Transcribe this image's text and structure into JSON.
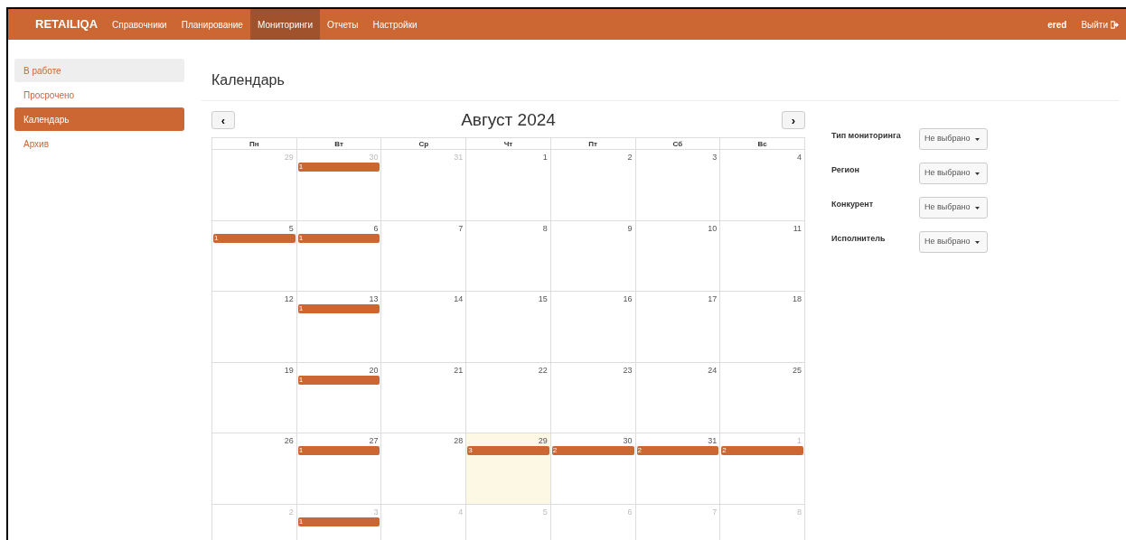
{
  "navbar": {
    "brand": "RETAILIQA",
    "items": [
      {
        "label": "Справочники",
        "selected": false
      },
      {
        "label": "Планирование",
        "selected": false
      },
      {
        "label": "Мониторинги",
        "selected": true
      },
      {
        "label": "Отчеты",
        "selected": false
      },
      {
        "label": "Настройки",
        "selected": false
      }
    ],
    "user": "ered",
    "logout": "Выйти"
  },
  "sidebar": {
    "items": [
      {
        "label": "В работе",
        "selected": false,
        "hovered": true
      },
      {
        "label": "Просрочено",
        "selected": false
      },
      {
        "label": "Календарь",
        "selected": true
      },
      {
        "label": "Архив",
        "selected": false
      }
    ]
  },
  "page_title": "Календарь",
  "calendar": {
    "prev": "‹",
    "next": "›",
    "month": "Август 2024",
    "weekdays": [
      "Пн",
      "Вт",
      "Ср",
      "Чт",
      "Пт",
      "Сб",
      "Вс"
    ],
    "weeks": [
      [
        {
          "day": "29",
          "other_month": true,
          "today": false
        },
        {
          "day": "30",
          "other_month": true,
          "today": false,
          "events": [
            "1"
          ]
        },
        {
          "day": "31",
          "other_month": true,
          "today": false
        },
        {
          "day": "1",
          "other_month": false,
          "today": false
        },
        {
          "day": "2",
          "other_month": false,
          "today": false
        },
        {
          "day": "3",
          "other_month": false,
          "today": false
        },
        {
          "day": "4",
          "other_month": false,
          "today": false
        }
      ],
      [
        {
          "day": "5",
          "other_month": false,
          "today": false,
          "events": [
            "1"
          ]
        },
        {
          "day": "6",
          "other_month": false,
          "today": false,
          "events": [
            "1"
          ]
        },
        {
          "day": "7",
          "other_month": false,
          "today": false
        },
        {
          "day": "8",
          "other_month": false,
          "today": false
        },
        {
          "day": "9",
          "other_month": false,
          "today": false
        },
        {
          "day": "10",
          "other_month": false,
          "today": false
        },
        {
          "day": "11",
          "other_month": false,
          "today": false
        }
      ],
      [
        {
          "day": "12",
          "other_month": false,
          "today": false
        },
        {
          "day": "13",
          "other_month": false,
          "today": false,
          "events": [
            "1"
          ]
        },
        {
          "day": "14",
          "other_month": false,
          "today": false
        },
        {
          "day": "15",
          "other_month": false,
          "today": false
        },
        {
          "day": "16",
          "other_month": false,
          "today": false
        },
        {
          "day": "17",
          "other_month": false,
          "today": false
        },
        {
          "day": "18",
          "other_month": false,
          "today": false
        }
      ],
      [
        {
          "day": "19",
          "other_month": false,
          "today": false
        },
        {
          "day": "20",
          "other_month": false,
          "today": false,
          "events": [
            "1"
          ]
        },
        {
          "day": "21",
          "other_month": false,
          "today": false
        },
        {
          "day": "22",
          "other_month": false,
          "today": false
        },
        {
          "day": "23",
          "other_month": false,
          "today": false
        },
        {
          "day": "24",
          "other_month": false,
          "today": false
        },
        {
          "day": "25",
          "other_month": false,
          "today": false
        }
      ],
      [
        {
          "day": "26",
          "other_month": false,
          "today": false
        },
        {
          "day": "27",
          "other_month": false,
          "today": false,
          "events": [
            "1"
          ]
        },
        {
          "day": "28",
          "other_month": false,
          "today": false
        },
        {
          "day": "29",
          "other_month": false,
          "today": true,
          "events": [
            "3"
          ]
        },
        {
          "day": "30",
          "other_month": false,
          "today": false,
          "events": [
            "2"
          ]
        },
        {
          "day": "31",
          "other_month": false,
          "today": false,
          "events": [
            "2"
          ]
        },
        {
          "day": "1",
          "other_month": true,
          "today": false,
          "events": [
            "2"
          ]
        }
      ],
      [
        {
          "day": "2",
          "other_month": true,
          "today": false
        },
        {
          "day": "3",
          "other_month": true,
          "today": false,
          "events": [
            "1"
          ]
        },
        {
          "day": "4",
          "other_month": true,
          "today": false
        },
        {
          "day": "5",
          "other_month": true,
          "today": false
        },
        {
          "day": "6",
          "other_month": true,
          "today": false
        },
        {
          "day": "7",
          "other_month": true,
          "today": false
        },
        {
          "day": "8",
          "other_month": true,
          "today": false
        }
      ]
    ]
  },
  "filters": [
    {
      "label": "Тип мониторинга",
      "value": "Не выбрано"
    },
    {
      "label": "Регион",
      "value": "Не выбрано"
    },
    {
      "label": "Конкурент",
      "value": "Не выбрано"
    },
    {
      "label": "Исполнитель",
      "value": "Не выбрано"
    }
  ]
}
